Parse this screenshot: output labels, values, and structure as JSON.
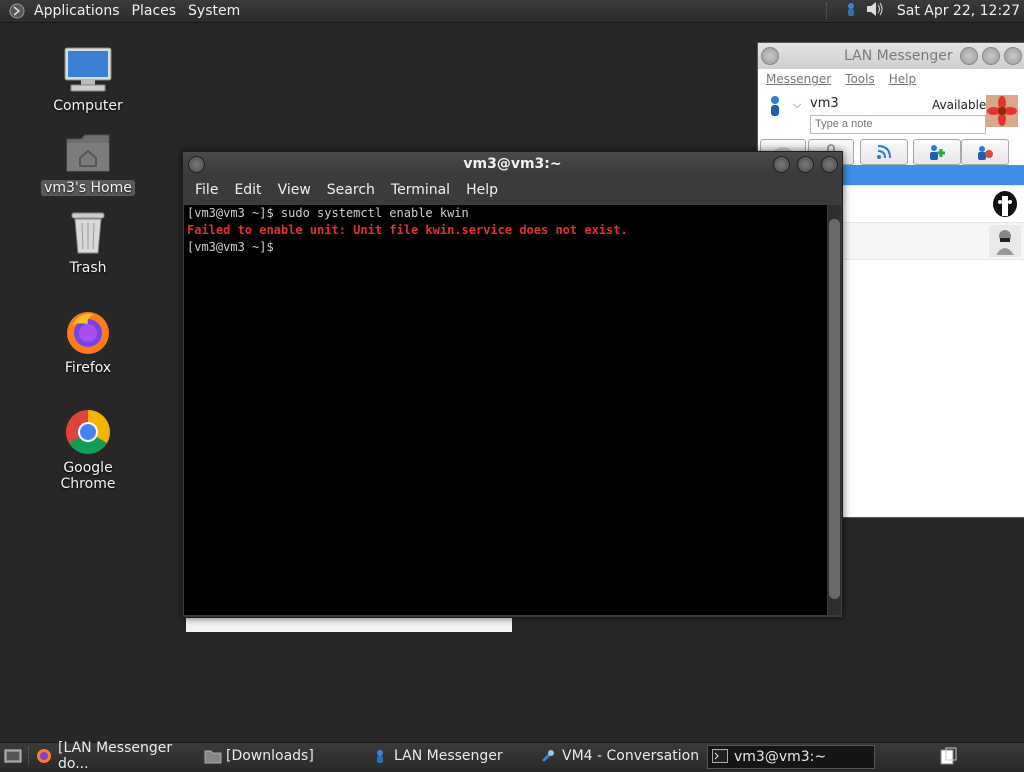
{
  "top_panel": {
    "menus": [
      "Applications",
      "Places",
      "System"
    ],
    "clock": "Sat Apr 22, 12:27"
  },
  "desktop_icons": [
    {
      "label": "Computer",
      "icon": "computer-icon"
    },
    {
      "label": "vm3's Home",
      "icon": "home-folder-icon"
    },
    {
      "label": "Trash",
      "icon": "trash-icon"
    },
    {
      "label": "Firefox",
      "icon": "firefox-icon"
    },
    {
      "label": "Google Chrome",
      "icon": "chrome-icon"
    }
  ],
  "lan_messenger": {
    "title": "LAN Messenger",
    "menu": [
      "Messenger",
      "Tools",
      "Help"
    ],
    "user": {
      "name": "vm3",
      "status": "Available",
      "note_placeholder": "Type a note"
    }
  },
  "terminal": {
    "title": "vm3@vm3:~",
    "menu": [
      "File",
      "Edit",
      "View",
      "Search",
      "Terminal",
      "Help"
    ],
    "lines": [
      {
        "text": "[vm3@vm3 ~]$ sudo systemctl enable kwin",
        "type": "normal"
      },
      {
        "text": "Failed to enable unit: Unit file kwin.service does not exist.",
        "type": "error"
      },
      {
        "text": "[vm3@vm3 ~]$ ",
        "type": "normal"
      }
    ]
  },
  "taskbar": {
    "tasks": [
      {
        "label": "[LAN Messenger do...",
        "icon": "firefox-icon"
      },
      {
        "label": "[Downloads]",
        "icon": "folder-icon"
      },
      {
        "label": "LAN Messenger",
        "icon": "lan-messenger-icon"
      },
      {
        "label": "VM4 - Conversation",
        "icon": "conversation-icon"
      },
      {
        "label": "vm3@vm3:~",
        "icon": "terminal-icon"
      }
    ]
  },
  "colors": {
    "desktop_bg": "#272727",
    "error_text": "#e53030",
    "selection": "#3d8ee6"
  }
}
